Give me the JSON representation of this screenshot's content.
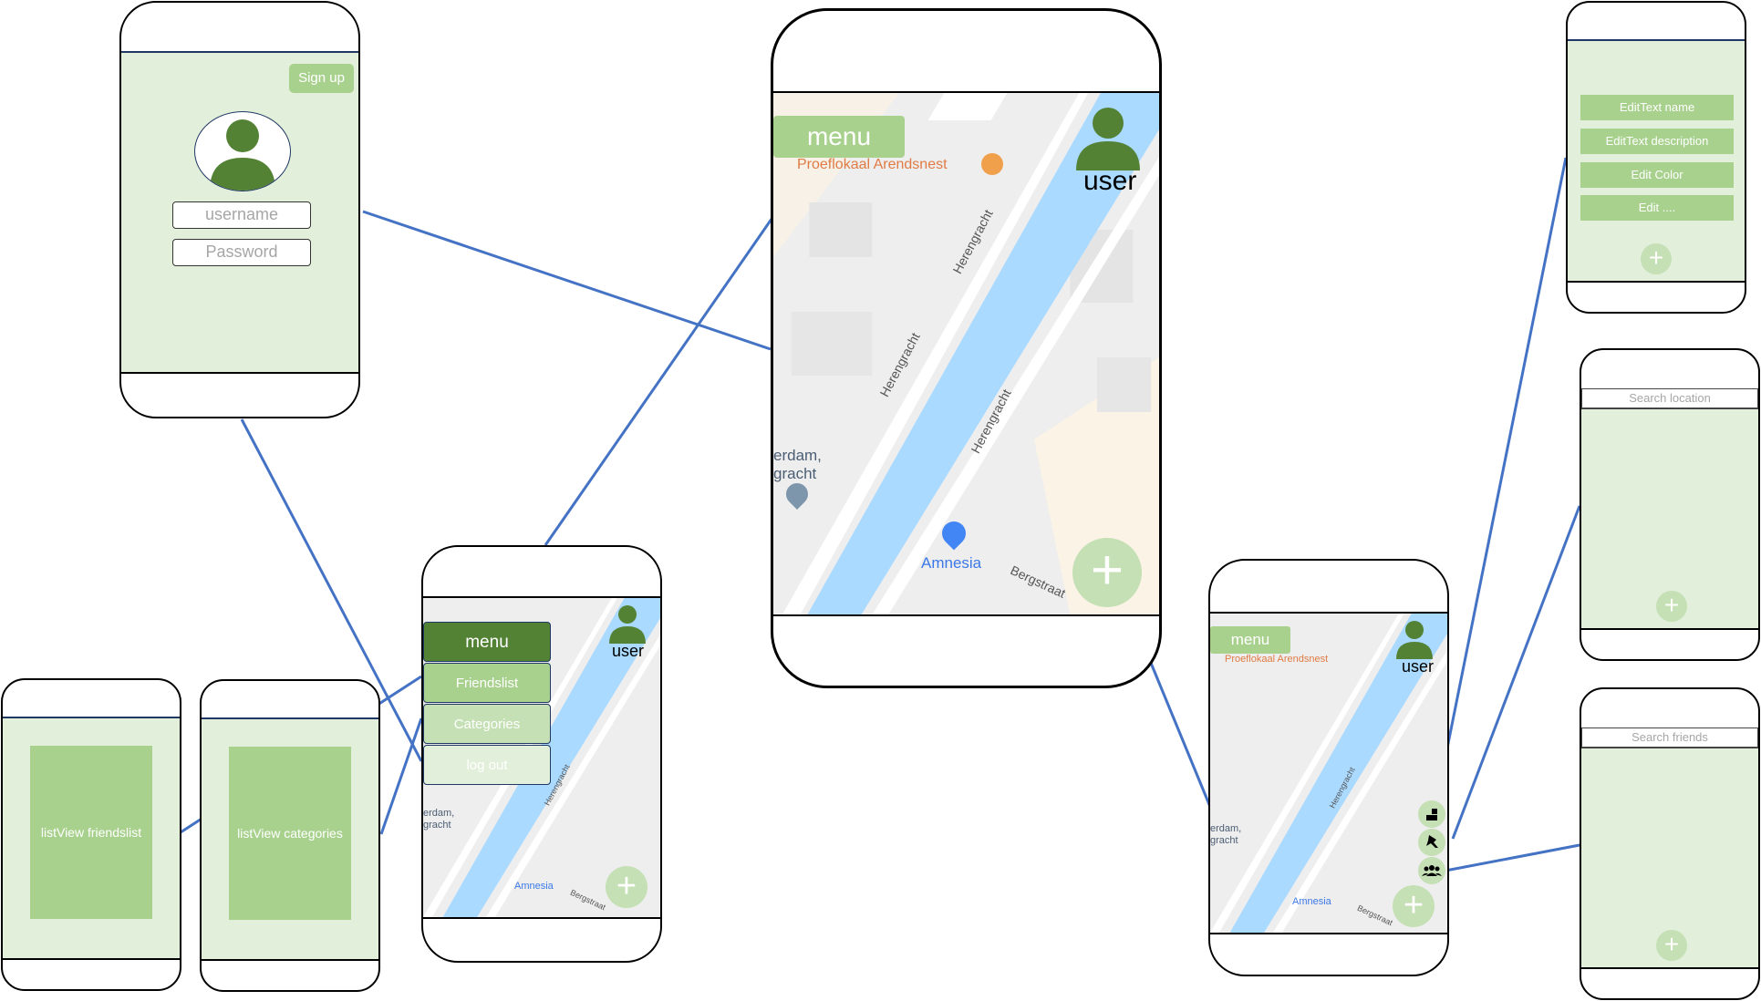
{
  "login": {
    "signup_label": "Sign up",
    "username_placeholder": "username",
    "password_placeholder": "Password"
  },
  "map": {
    "menu_label": "menu",
    "user_label": "user",
    "poi_cafe": "Proeflokaal Arendsnest",
    "poi_shop": "Amnesia",
    "street_herengracht": "Herengracht",
    "street_bergstraat": "Bergstraat",
    "place_partial_1": "erdam,",
    "place_partial_2": "gracht",
    "plus_icon": "+"
  },
  "menu_panel": {
    "menu_label": "menu",
    "items": [
      "Friendslist",
      "Categories",
      "log out"
    ]
  },
  "lists": {
    "friendslist": "listView friendslist",
    "categories": "listView categories"
  },
  "edit_screen": {
    "items": [
      "EditText name",
      "EditText description",
      "Edit Color",
      "Edit ...."
    ]
  },
  "search_location": {
    "placeholder": "Search location"
  },
  "search_friends": {
    "placeholder": "Search friends"
  },
  "colors": {
    "screen_bg": "#e2efda",
    "button": "#a9d18e",
    "dark_green": "#548235",
    "link_line": "#4472c4",
    "water": "#aadaff"
  }
}
